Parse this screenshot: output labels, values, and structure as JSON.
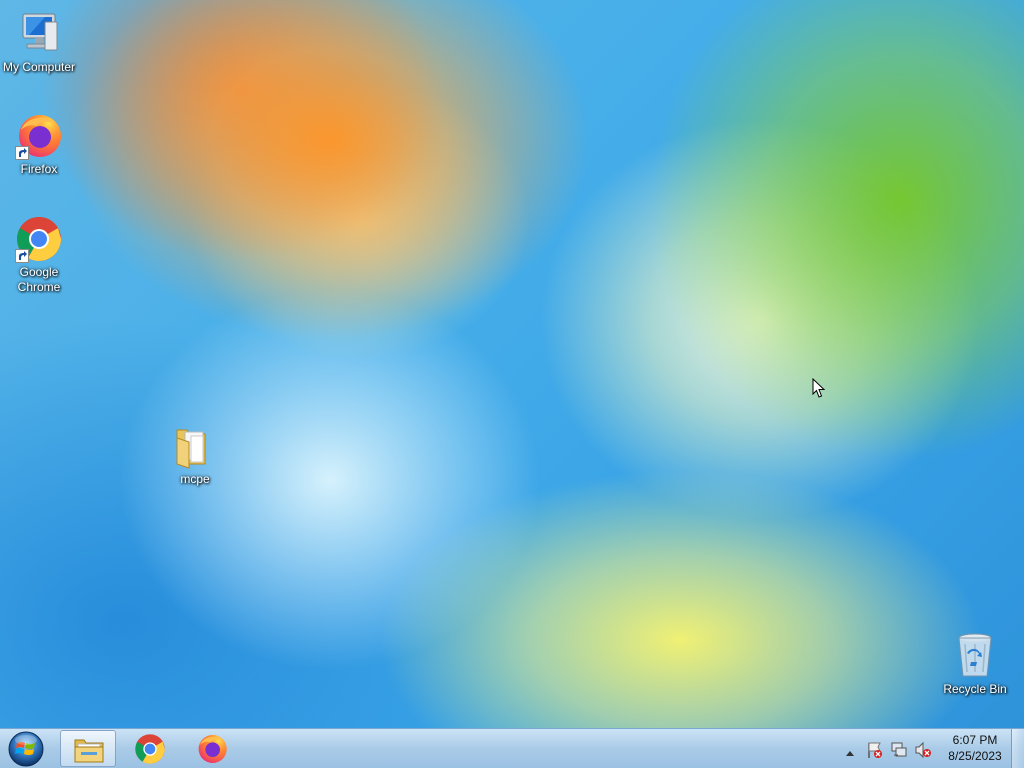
{
  "desktop": {
    "icons": [
      {
        "label": "My Computer",
        "icon": "computer-icon"
      },
      {
        "label": "Firefox",
        "icon": "firefox-icon",
        "shortcut": true
      },
      {
        "label_line1": "Google",
        "label_line2": "Chrome",
        "icon": "chrome-icon",
        "shortcut": true
      },
      {
        "label": "mcpe",
        "icon": "folder-icon"
      },
      {
        "label": "Recycle Bin",
        "icon": "recycle-bin-icon"
      }
    ]
  },
  "taskbar": {
    "start": {
      "icon": "windows-start-icon"
    },
    "pinned": [
      {
        "icon": "file-explorer-icon",
        "active": true
      },
      {
        "icon": "chrome-icon"
      },
      {
        "icon": "firefox-icon"
      }
    ],
    "tray": {
      "icons": [
        "show-hidden-icons-arrow",
        "action-center-flag-icon",
        "network-icon",
        "volume-muted-icon"
      ],
      "time": "6:07 PM",
      "date": "8/25/2023"
    }
  },
  "colors": {
    "taskbar": "#a8c8e6",
    "desktop_base": "#3aa6e6"
  }
}
